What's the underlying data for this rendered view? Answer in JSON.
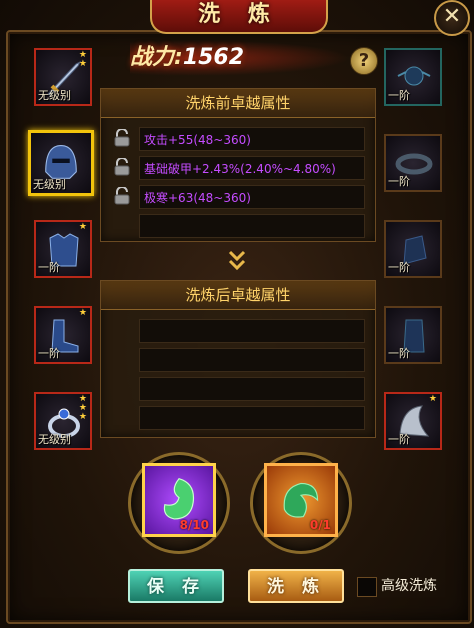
{
  "title": "洗 炼",
  "power": {
    "label": "战力:",
    "value": "1562"
  },
  "help_label": "?",
  "close_label": "✕",
  "before_panel": {
    "title": "洗炼前卓越属性",
    "rows": [
      "攻击+55(48~360)",
      "基础破甲+2.43%(2.40%~4.80%)",
      "极寒+63(48~360)",
      ""
    ]
  },
  "after_panel": {
    "title": "洗炼后卓越属性",
    "rows": [
      "",
      "",
      "",
      ""
    ]
  },
  "left_slots": [
    {
      "label": "无级别",
      "stars": 2,
      "item": "sword-icon"
    },
    {
      "label": "无级别",
      "stars": 0,
      "item": "helmet-icon",
      "selected": true
    },
    {
      "label": "一阶",
      "stars": 1,
      "item": "armor-icon"
    },
    {
      "label": "一阶",
      "stars": 1,
      "item": "boots-icon"
    },
    {
      "label": "无级别",
      "stars": 3,
      "item": "ring-icon"
    }
  ],
  "right_slots": [
    {
      "label": "一阶",
      "item": "amulet-icon"
    },
    {
      "label": "一阶",
      "item": "belt-icon"
    },
    {
      "label": "一阶",
      "item": "gauntlet-icon"
    },
    {
      "label": "一阶",
      "item": "bracer-icon"
    },
    {
      "label": "一阶",
      "stars": 1,
      "item": "shoulder-icon"
    }
  ],
  "materials": [
    {
      "item": "green-jade-icon",
      "count": "8/10",
      "color": "#8a2ed8"
    },
    {
      "item": "dragon-jade-icon",
      "count": "0/1",
      "color": "#e07418"
    }
  ],
  "buttons": {
    "save": "保 存",
    "wash": "洗 炼"
  },
  "advanced_label": "高级洗炼"
}
